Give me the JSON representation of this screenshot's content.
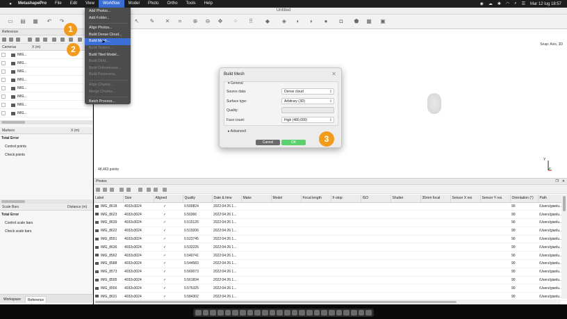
{
  "menubar": {
    "app": "MetashapePro",
    "items": [
      "File",
      "Edit",
      "View",
      "Workflow",
      "Model",
      "Photo",
      "Ortho",
      "Tools",
      "Help"
    ],
    "active": "Workflow",
    "clock": "Mar 12 lug  18:57"
  },
  "window": {
    "title": "Untitled"
  },
  "reference_panel": {
    "title": "Reference",
    "camera_columns": [
      "Cameras",
      "X (m)"
    ],
    "cameras": [
      "IMG...",
      "IMG...",
      "IMG...",
      "IMG...",
      "IMG...",
      "IMG...",
      "IMG...",
      "IMG..."
    ],
    "marker_columns": [
      "Markers",
      "X (m)"
    ],
    "markers_total": "Total Error",
    "markers_items": [
      "Control points",
      "Check points"
    ],
    "scalebar_columns": [
      "Scale Bars",
      "Distance (m)"
    ],
    "scalebars_total": "Total Error",
    "scalebars_items": [
      "Control scale bars",
      "Check scale bars"
    ]
  },
  "bottom_tabs": [
    "Workspace",
    "Reference"
  ],
  "workflow_menu": {
    "items": [
      {
        "label": "Add Photos...",
        "enabled": true
      },
      {
        "label": "Add Folder...",
        "enabled": true
      },
      {
        "label": "Align Photos...",
        "enabled": true
      },
      {
        "label": "Build Dense Cloud...",
        "enabled": true
      },
      {
        "label": "Build Mesh...",
        "enabled": true,
        "highlighted": true
      },
      {
        "label": "Build Texture...",
        "enabled": false
      },
      {
        "label": "Build Tiled Model...",
        "enabled": true
      },
      {
        "label": "Build DEM...",
        "enabled": false
      },
      {
        "label": "Build Orthomosaic...",
        "enabled": false
      },
      {
        "label": "Build Panorama...",
        "enabled": false
      },
      {
        "label": "Align Chunks...",
        "enabled": false
      },
      {
        "label": "Merge Chunks...",
        "enabled": false
      },
      {
        "label": "Batch Process...",
        "enabled": true
      }
    ]
  },
  "model_view": {
    "snap": "Snap: Axis, 3D",
    "points": "48,463 points"
  },
  "dialog": {
    "title": "Build Mesh",
    "general": "General",
    "fields": [
      {
        "label": "Source data:",
        "value": "Dense cloud",
        "enabled": true
      },
      {
        "label": "Surface type:",
        "value": "Arbitrary (3D)",
        "enabled": true
      },
      {
        "label": "Quality:",
        "value": "",
        "enabled": false
      },
      {
        "label": "Face count:",
        "value": "High (480,000)",
        "enabled": true
      }
    ],
    "advanced": "Advanced",
    "cancel": "Cancel",
    "ok": "OK"
  },
  "badges": [
    "1",
    "2",
    "3"
  ],
  "photos_panel": {
    "title": "Photos",
    "columns": [
      "Label",
      "Size",
      "Aligned",
      "Quality",
      "Date & time",
      "Make",
      "Model",
      "Focal length",
      "F-stop",
      "ISO",
      "Shutter",
      "35mm focal",
      "Sensor X res",
      "Sensor Y res",
      "Orientation (°)",
      "Path"
    ],
    "rows": [
      [
        "IMG_8618",
        "4032x3024",
        "✓",
        "0.500824",
        "2022:04:26 1...",
        "90",
        "/Users/gianlu..."
      ],
      [
        "IMG_8623",
        "4032x3024",
        "✓",
        "0.50366",
        "2022:04:26 1...",
        "90",
        "/Users/gianlu..."
      ],
      [
        "IMG_8639",
        "4032x3024",
        "✓",
        "0.515126",
        "2022:04:26 1...",
        "90",
        "/Users/gianlu..."
      ],
      [
        "IMG_8622",
        "4032x3024",
        "✓",
        "0.519206",
        "2022:04:26 1...",
        "90",
        "/Users/gianlu..."
      ],
      [
        "IMG_8551",
        "4032x3024",
        "✓",
        "0.523745",
        "2022:04:26 1...",
        "90",
        "/Users/gianlu..."
      ],
      [
        "IMG_8636",
        "4032x3024",
        "✓",
        "0.532226",
        "2022:04:26 1...",
        "90",
        "/Users/gianlu..."
      ],
      [
        "IMG_8562",
        "4032x3024",
        "✓",
        "0.540741",
        "2022:04:26 1...",
        "90",
        "/Users/gianlu..."
      ],
      [
        "IMG_8588",
        "4032x3024",
        "✓",
        "0.544583",
        "2022:04:26 1...",
        "90",
        "/Users/gianlu..."
      ],
      [
        "IMG_8573",
        "4032x3024",
        "✓",
        "0.560073",
        "2022:04:26 1...",
        "90",
        "/Users/gianlu..."
      ],
      [
        "IMG_8595",
        "4032x3024",
        "✓",
        "0.561834",
        "2022:04:26 1...",
        "90",
        "/Users/gianlu..."
      ],
      [
        "IMG_8556",
        "4032x3024",
        "✓",
        "0.575325",
        "2022:04:26 1...",
        "90",
        "/Users/gianlu..."
      ],
      [
        "IMG_8631",
        "4032x3024",
        "✓",
        "0.584302",
        "2022:04:26 1...",
        "90",
        "/Users/gianlu..."
      ]
    ]
  },
  "colors": {
    "accent": "#3b6fd6",
    "badge": "#f29a1c",
    "ok": "#5ccf6e"
  }
}
